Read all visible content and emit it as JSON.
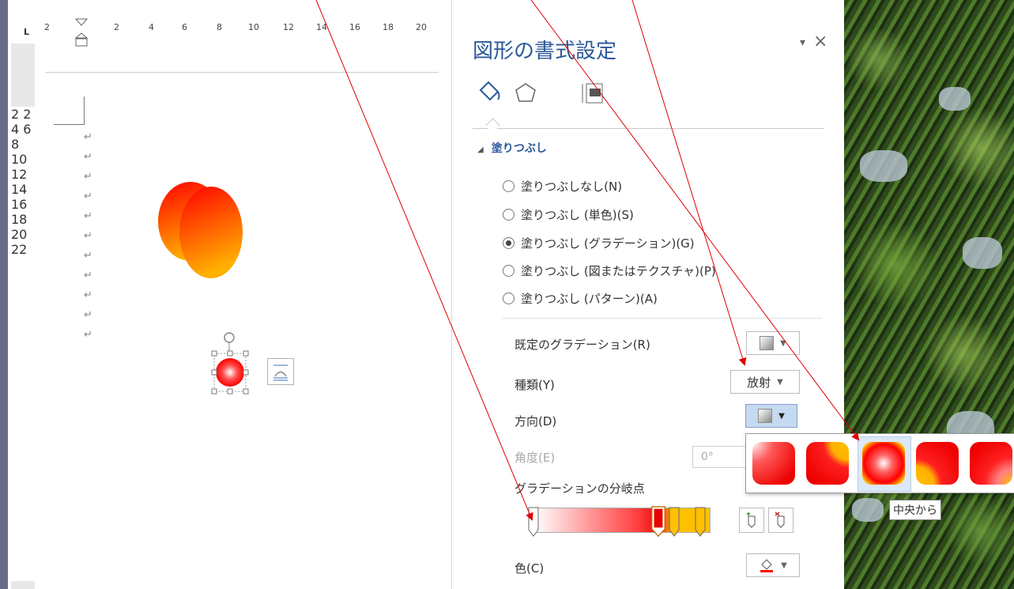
{
  "ruler": {
    "corner": "L",
    "h_numbers": [
      "2",
      "2",
      "4",
      "6",
      "8",
      "10",
      "12",
      "14",
      "16",
      "18",
      "20"
    ],
    "v_numbers": [
      "2",
      "2",
      "4",
      "6",
      "8",
      "10",
      "12",
      "14",
      "16",
      "18",
      "20",
      "22"
    ]
  },
  "document": {
    "paragraph_mark": "↵"
  },
  "pane": {
    "title": "図形の書式設定",
    "dropdown_glyph": "▾",
    "close_glyph": "×",
    "tabs": [
      "fill-line-icon",
      "effects-icon",
      "size-properties-icon"
    ],
    "section_title": "塗りつぶし",
    "fill_options": [
      {
        "label": "塗りつぶしなし(N)",
        "checked": false
      },
      {
        "label": "塗りつぶし (単色)(S)",
        "checked": false
      },
      {
        "label": "塗りつぶし (グラデーション)(G)",
        "checked": true
      },
      {
        "label": "塗りつぶし (図またはテクスチャ)(P)",
        "checked": false
      },
      {
        "label": "塗りつぶし (パターン)(A)",
        "checked": false
      }
    ],
    "preset_gradient_label": "既定のグラデーション(R)",
    "type_label": "種類(Y)",
    "type_value": "放射",
    "direction_label": "方向(D)",
    "angle_label": "角度(E)",
    "angle_value": "0°",
    "stops_label": "グラデーションの分岐点",
    "color_label": "色(C)"
  },
  "direction_popup": {
    "tooltip": "中央から",
    "selected_index": 2
  },
  "colors": {
    "accent": "#2b579a",
    "red": "#ff0000",
    "orange": "#ffc000",
    "arrow": "#e00000"
  }
}
